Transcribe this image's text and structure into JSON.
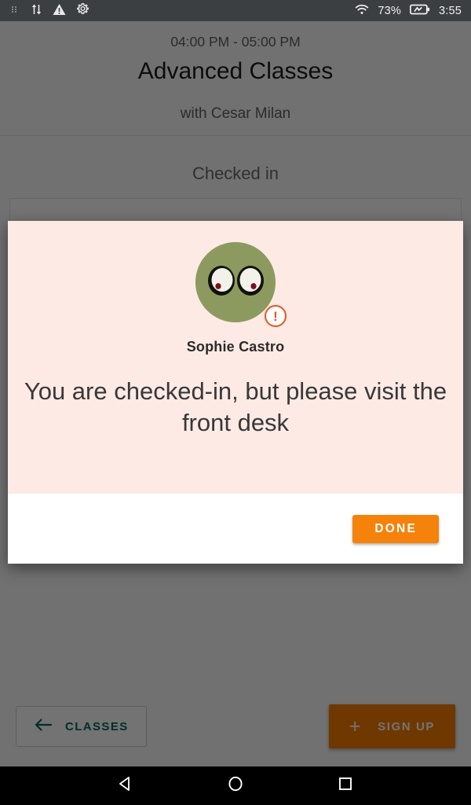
{
  "statusbar": {
    "icons_left": [
      "dots-icon",
      "sync-arrows-icon",
      "warning-triangle-icon",
      "gear-icon"
    ],
    "wifi_icon": "wifi-icon",
    "battery_percent": "73%",
    "battery_icon": "battery-charging-icon",
    "clock": "3:55"
  },
  "header": {
    "time_range": "04:00 PM - 05:00 PM",
    "title": "Advanced Classes",
    "instructor": "with Cesar Milan"
  },
  "content": {
    "section_label": "Checked in"
  },
  "bottom_bar": {
    "back_icon": "arrow-left-icon",
    "back_label": "CLASSES",
    "signup_icon": "plus-icon",
    "signup_label": "SIGN UP"
  },
  "dialog": {
    "avatar_name": "avatar-image",
    "badge_icon": "exclamation-badge-icon",
    "badge_symbol": "!",
    "person_name": "Sophie Castro",
    "message": "You are checked-in, but please visit the front desk",
    "done_label": "DONE"
  },
  "navbar": {
    "back": "nav-back-icon",
    "home": "nav-home-icon",
    "recents": "nav-recents-icon"
  },
  "colors": {
    "accent_orange": "#f5820b",
    "dialog_pink": "#fdeae4",
    "teal": "#00695c",
    "badge_orange": "#e8561f",
    "avatar_green": "#8d9a5f"
  }
}
